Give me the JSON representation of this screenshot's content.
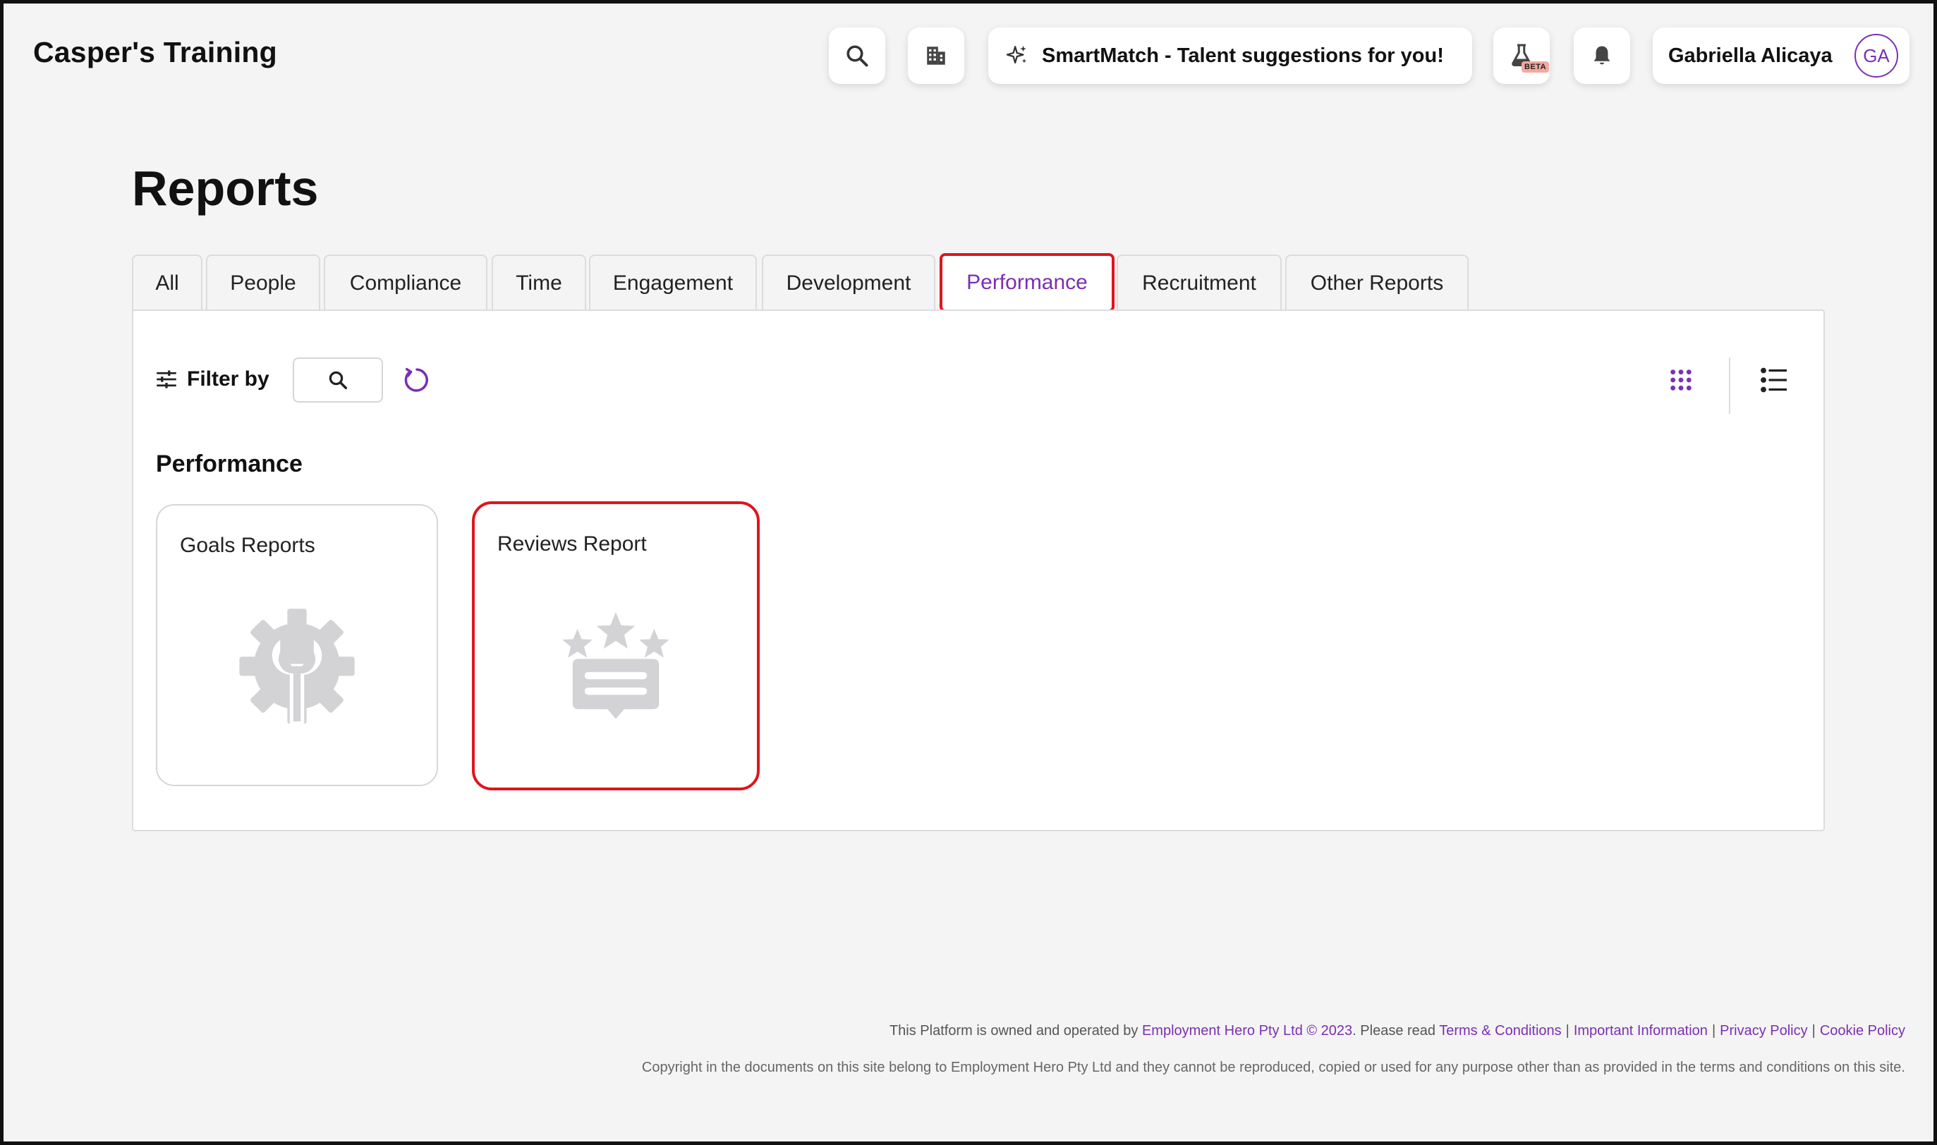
{
  "app": {
    "brand": "Casper's Training"
  },
  "topbar": {
    "smartmatch_label": "SmartMatch - Talent suggestions for you!",
    "beta_badge": "BETA",
    "user_name": "Gabriella Alicaya",
    "user_initials": "GA"
  },
  "page": {
    "title": "Reports"
  },
  "tabs": [
    {
      "label": "All"
    },
    {
      "label": "People"
    },
    {
      "label": "Compliance"
    },
    {
      "label": "Time"
    },
    {
      "label": "Engagement"
    },
    {
      "label": "Development"
    },
    {
      "label": "Performance",
      "active": true
    },
    {
      "label": "Recruitment"
    },
    {
      "label": "Other Reports"
    }
  ],
  "filter": {
    "label": "Filter by"
  },
  "section": {
    "heading": "Performance",
    "cards": [
      {
        "title": "Goals Reports",
        "icon": "gear-wrench-icon"
      },
      {
        "title": "Reviews Report",
        "icon": "stars-review-icon"
      }
    ]
  },
  "footer": {
    "prefix": "This Platform is owned and operated by",
    "owner": "Employment Hero Pty Ltd © 2023",
    "please_read": ". Please read",
    "links": [
      "Terms & Conditions",
      "Important Information",
      "Privacy Policy",
      "Cookie Policy"
    ],
    "copyright": "Copyright in the documents on this site belong to Employment Hero Pty Ltd and they cannot be reproduced, copied or used for any purpose other than as provided in the terms and conditions on this site."
  },
  "colors": {
    "accent": "#7b2fb3",
    "highlight": "#e0141e",
    "icon_grey": "#d3d3d6"
  }
}
